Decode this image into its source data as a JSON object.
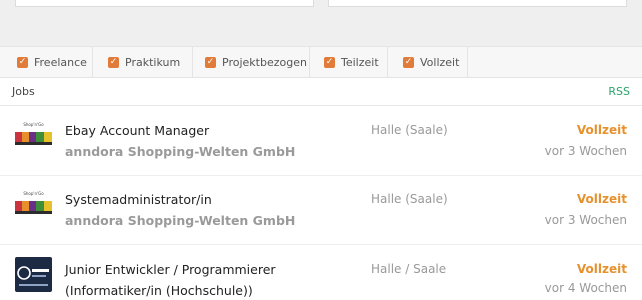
{
  "filters": [
    {
      "label": "Freelance"
    },
    {
      "label": "Praktikum"
    },
    {
      "label": "Projektbezogen"
    },
    {
      "label": "Teilzeit"
    },
    {
      "label": "Vollzeit"
    }
  ],
  "jobs_section": {
    "label": "Jobs",
    "rss_label": "RSS"
  },
  "jobs": [
    {
      "title": "Ebay Account Manager",
      "company": "anndora Shopping-Welten GmbH",
      "location": "Halle (Saale)",
      "type": "Vollzeit",
      "age": "vor 3 Wochen",
      "logo_icon": "anndora-logo-icon"
    },
    {
      "title": "Systemadministrator/in",
      "company": "anndora Shopping-Welten GmbH",
      "location": "Halle (Saale)",
      "type": "Vollzeit",
      "age": "vor 3 Wochen",
      "logo_icon": "anndora-logo-icon"
    },
    {
      "title": "Junior Entwickler / Programmierer",
      "subtitle": "(Informatiker/in (Hochschule))",
      "location": "Halle / Saale",
      "type": "Vollzeit",
      "age": "vor 4 Wochen",
      "logo_icon": "intecio-logo-icon"
    }
  ],
  "colors": {
    "accent_orange": "#e07b3a",
    "job_type": "#e6912e",
    "rss_green": "#2aa36a"
  }
}
